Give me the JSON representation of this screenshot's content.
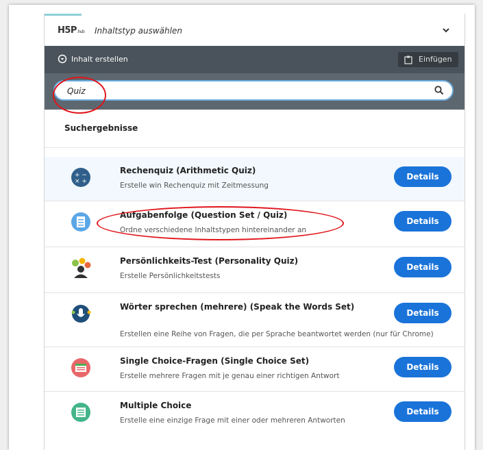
{
  "header": {
    "logo": "H5P",
    "logo_suffix": ".hub",
    "title": "Inhaltstyp auswählen",
    "collapse_icon": "chevron-down-icon"
  },
  "toolbar": {
    "create_label": "Inhalt erstellen",
    "paste_label": "Einfügen"
  },
  "search": {
    "value": "Quiz",
    "icon": "search-icon"
  },
  "results": {
    "heading": "Suchergebnisse",
    "details_label": "Details",
    "items": [
      {
        "title": "Rechenquiz (Arithmetic Quiz)",
        "desc": "Erstelle win Rechenquiz mit Zeitmessung"
      },
      {
        "title": "Aufgabenfolge (Question Set / Quiz)",
        "desc": "Ordne verschiedene Inhaltstypen hintereinander an"
      },
      {
        "title": "Persönlichkeits-Test (Personality Quiz)",
        "desc": "Erstelle Persönlichkeitstests"
      },
      {
        "title": "Wörter sprechen (mehrere) (Speak the Words Set)",
        "desc": "Erstellen eine Reihe von Fragen, die per Sprache beantwortet werden (nur für Chrome)"
      },
      {
        "title": "Single Choice-Fragen (Single Choice Set)",
        "desc": "Erstelle mehrere Fragen mit je genau einer richtigen Antwort"
      },
      {
        "title": "Multiple Choice",
        "desc": "Erstelle eine einzige Frage mit einer oder mehreren Antworten"
      }
    ]
  },
  "colors": {
    "toolbar": "#4a535b",
    "search_bar": "#5d6770",
    "details_button": "#1a73d9",
    "annotation": "#e0151b"
  }
}
